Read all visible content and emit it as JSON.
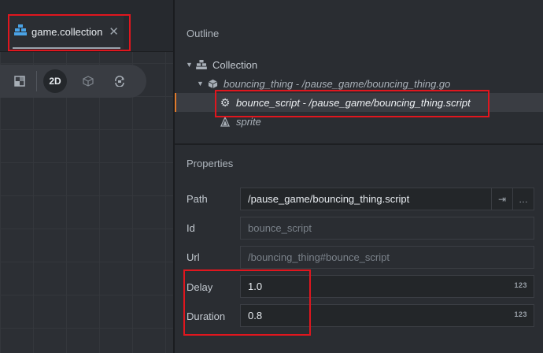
{
  "tab": {
    "label": "game.collection",
    "close": "✕"
  },
  "toolbar": {
    "mode_label": "2D"
  },
  "outline": {
    "title": "Outline",
    "items": [
      {
        "label": "Collection"
      },
      {
        "label": "bouncing_thing - /pause_game/bouncing_thing.go"
      },
      {
        "label": "bounce_script - /pause_game/bouncing_thing.script"
      },
      {
        "label": "sprite"
      }
    ]
  },
  "properties": {
    "title": "Properties",
    "path": {
      "label": "Path",
      "value": "/pause_game/bouncing_thing.script"
    },
    "id": {
      "label": "Id",
      "value": "bounce_script"
    },
    "url": {
      "label": "Url",
      "value": "/bouncing_thing#bounce_script"
    },
    "delay": {
      "label": "Delay",
      "value": "1.0",
      "badge": "123"
    },
    "duration": {
      "label": "Duration",
      "value": "0.8",
      "badge": "123"
    }
  }
}
